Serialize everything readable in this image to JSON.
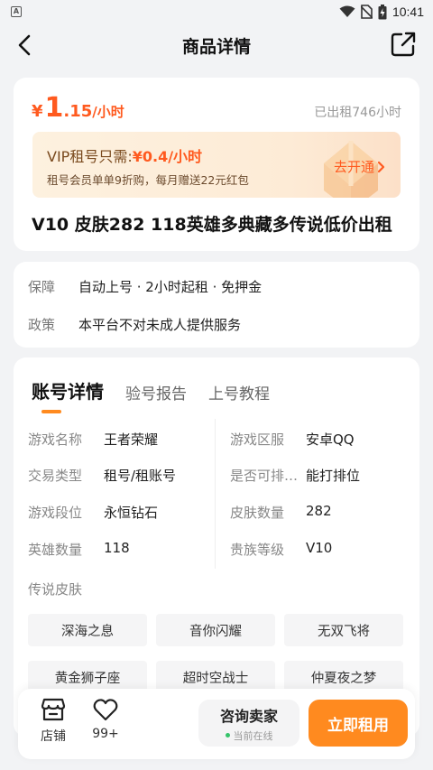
{
  "status_bar": {
    "time": "10:41",
    "icons": [
      "a-notification-icon",
      "wifi-icon",
      "no-sim-icon",
      "battery-charging-icon"
    ]
  },
  "nav": {
    "title": "商品详情",
    "back_icon": "back-arrow-icon",
    "share_icon": "share-icon"
  },
  "price": {
    "yen": "¥",
    "integer": "1",
    "decimal": ".15",
    "unit": "/小时",
    "rented": "已出租746小时"
  },
  "vip": {
    "label": "VIP租号只需:",
    "price": "¥0.4/小时",
    "desc": "租号会员单单9折购，每月赠送22元红包",
    "action": "去开通"
  },
  "product_title": "V10 皮肤282 118英雄多典藏多传说低价出租",
  "info": [
    {
      "label": "保障",
      "value": "自动上号 · 2小时起租 · 免押金"
    },
    {
      "label": "政策",
      "value": "本平台不对未成人提供服务"
    }
  ],
  "tabs": [
    {
      "label": "账号详情",
      "active": true
    },
    {
      "label": "验号报告",
      "active": false
    },
    {
      "label": "上号教程",
      "active": false
    }
  ],
  "details": {
    "left": [
      {
        "k": "游戏名称",
        "v": "王者荣耀"
      },
      {
        "k": "交易类型",
        "v": "租号/租账号"
      },
      {
        "k": "游戏段位",
        "v": "永恒钻石"
      },
      {
        "k": "英雄数量",
        "v": "118"
      }
    ],
    "right": [
      {
        "k": "游戏区服",
        "v": "安卓QQ"
      },
      {
        "k": "是否可排…",
        "v": "能打排位"
      },
      {
        "k": "皮肤数量",
        "v": "282"
      },
      {
        "k": "贵族等级",
        "v": "V10"
      }
    ]
  },
  "skins": {
    "label": "传说皮肤",
    "items": [
      "深海之息",
      "音你闪耀",
      "无双飞将",
      "黄金狮子座",
      "超时空战士",
      "仲夏夜之梦"
    ]
  },
  "bottom": {
    "store_label": "店铺",
    "favorite_count": "99+",
    "consult_label": "咨询卖家",
    "online_label": "当前在线",
    "rent_label": "立即租用"
  },
  "colors": {
    "accent": "#ff8a1f",
    "price": "#ff5a1f",
    "online": "#35c46a"
  }
}
